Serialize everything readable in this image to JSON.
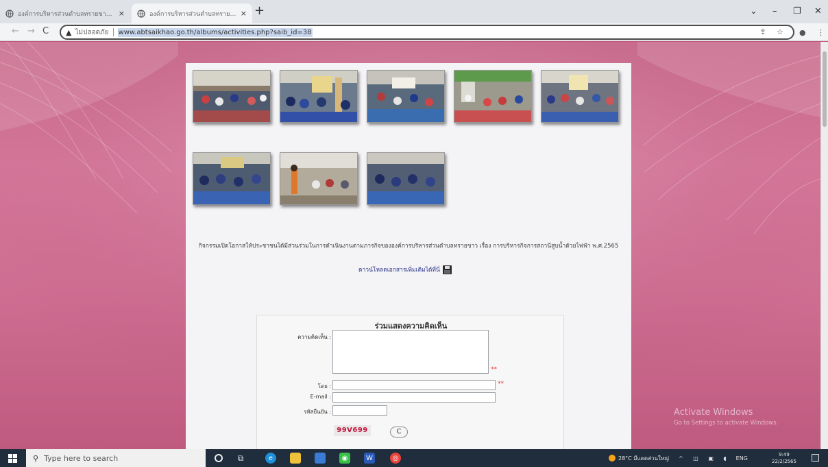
{
  "browser": {
    "tabs": [
      {
        "title": "องค์การบริหารส่วนตำบลทรายขาว อำเภอ",
        "close": "×"
      },
      {
        "title": "องค์การบริหารส่วนตำบลทรายขาว อำเภอ",
        "close": "×"
      }
    ],
    "new_tab": "+",
    "window_controls": {
      "dropdown": "⌄",
      "minimize": "–",
      "maximize": "❐",
      "close": "✕"
    },
    "nav": {
      "back": "←",
      "forward": "→",
      "reload": "C"
    },
    "security_label": "ไม่ปลอดภัย",
    "url": "www.abtsaikhao.go.th/albums/activities.php?saib_id=38"
  },
  "page": {
    "caption": "กิจกรรมเปิดโอกาสให้ประชาชนได้มีส่วนร่วมในการดำเนินงานตามภารกิจขององค์การบริหารส่วนตำบลทรายขาว เรื่อง การบริหารกิจการสถานีสูบน้ำด้วยไฟฟ้า พ.ศ.2565",
    "download_label": "ดาวน์โหลดเอกสารเพิ่มเติมได้ที่นี่",
    "photos": [
      {
        "name": "activity-photo-1"
      },
      {
        "name": "activity-photo-2"
      },
      {
        "name": "activity-photo-3"
      },
      {
        "name": "activity-photo-4"
      },
      {
        "name": "activity-photo-5"
      },
      {
        "name": "activity-photo-6"
      },
      {
        "name": "activity-photo-7"
      },
      {
        "name": "activity-photo-8"
      }
    ],
    "comment_form": {
      "title": "ร่วมแสดงความคิดเห็น",
      "comment_label": "ความคิดเห็น :",
      "by_label": "โดย :",
      "email_label": "E-mail :",
      "code_label": "รหัสยืนยัน :",
      "required_mark": "**",
      "captcha_text": "99V699",
      "refresh_symbol": "C"
    }
  },
  "watermark": {
    "line1": "Activate Windows",
    "line2": "Go to Settings to activate Windows."
  },
  "taskbar": {
    "search_placeholder": "Type here to search",
    "weather": "28°C มีแดดส่วนใหญ่",
    "lang": "ENG",
    "time": "9:49",
    "date": "22/2/2565"
  }
}
